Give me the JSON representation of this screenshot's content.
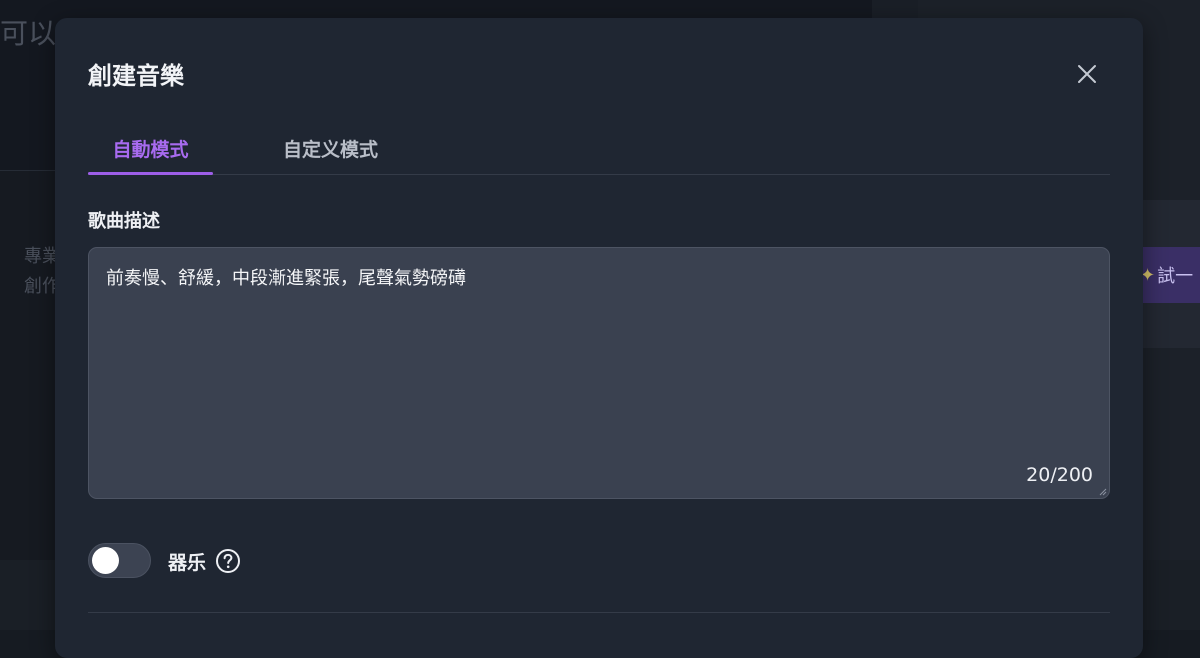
{
  "background": {
    "headline": "可以",
    "line1": "專業",
    "line2": "創作",
    "try_button": "試一"
  },
  "modal": {
    "title": "創建音樂",
    "close_icon": "close-icon",
    "tabs": [
      {
        "label": "自動模式",
        "active": true
      },
      {
        "label": "自定义模式",
        "active": false
      }
    ],
    "description": {
      "label": "歌曲描述",
      "value": "前奏慢、舒緩，中段漸進緊張，尾聲氣勢磅礡",
      "char_count": "20/200"
    },
    "instrumental": {
      "label": "器乐",
      "enabled": false,
      "help_icon": "help-circle-icon"
    }
  },
  "colors": {
    "accent": "#a86bf0",
    "modal_bg": "#1f2632",
    "input_bg": "#3a4150"
  }
}
